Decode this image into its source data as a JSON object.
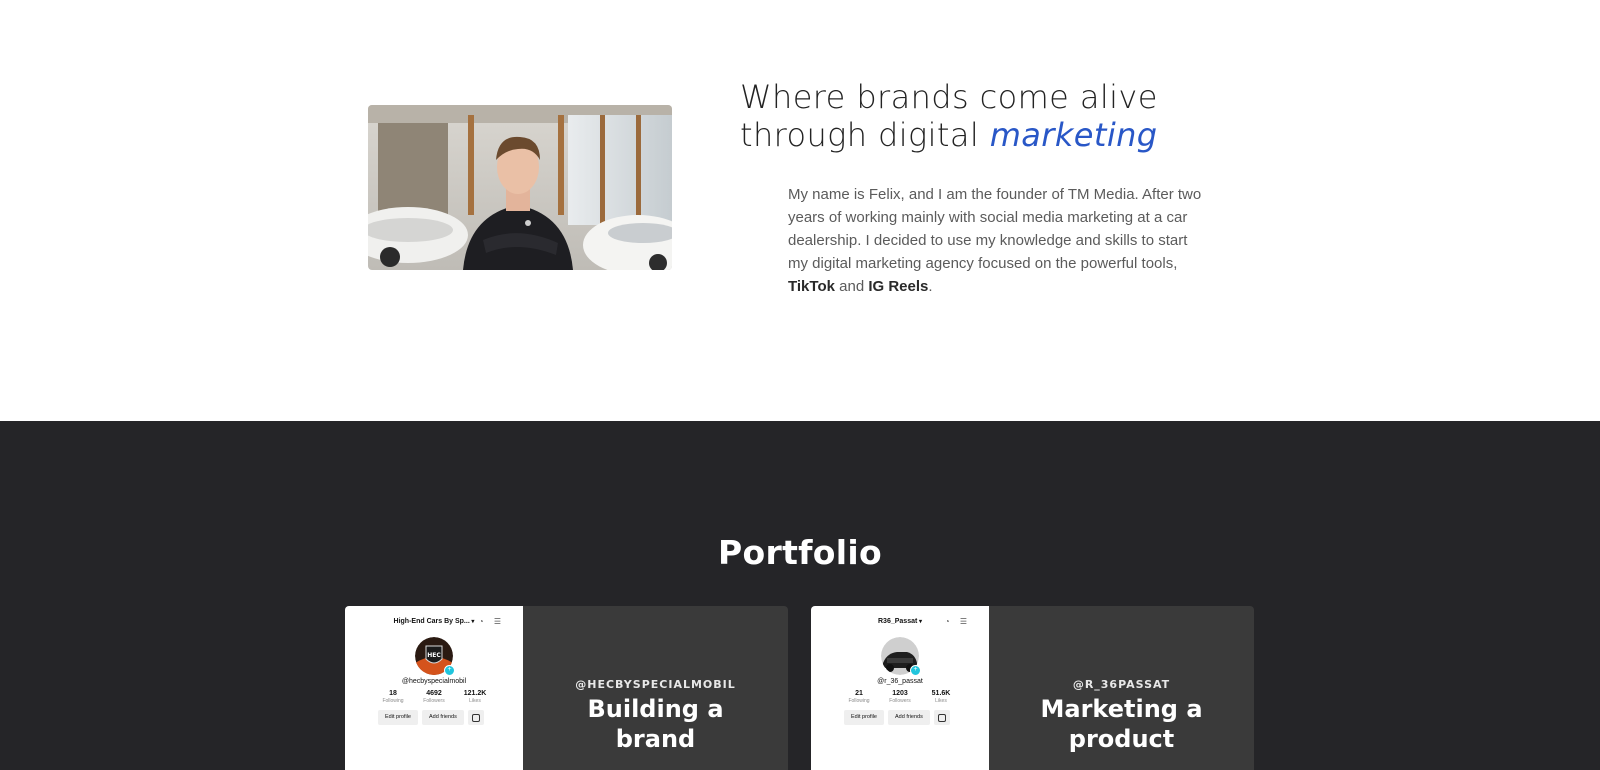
{
  "about": {
    "headline_line1": "Where brands come alive",
    "headline_line2_prefix": "through digital ",
    "headline_accent": "marketing",
    "bio_intro": "My name is Felix, and I am the founder of TM Media. After two years of working mainly with social media marketing at a car dealership. I decided to use my knowledge and skills to start my digital marketing agency focused on the powerful tools, ",
    "bio_tool1": "TikTok",
    "bio_and": " and ",
    "bio_tool2": "IG Reels",
    "bio_end": ".",
    "accent_color": "#2957c7"
  },
  "portfolio": {
    "title": "Portfolio",
    "background": "#252528",
    "cards": [
      {
        "handle": "@HECBYSPECIALMOBIL",
        "title": "Building a brand",
        "screenshot": {
          "account_name": "High-End Cars By Sp...",
          "username": "@hecbyspecialmobil",
          "following": "18",
          "following_label": "Following",
          "followers": "4692",
          "followers_label": "Followers",
          "likes": "121.2K",
          "likes_label": "Likes",
          "edit_profile": "Edit profile",
          "add_friends": "Add friends",
          "avatar_text": "HEC"
        }
      },
      {
        "handle": "@R_36PASSAT",
        "title": "Marketing a product",
        "screenshot": {
          "account_name": "R36_Passat",
          "username": "@r_36_passat",
          "following": "21",
          "following_label": "Following",
          "followers": "1203",
          "followers_label": "Followers",
          "likes": "51.6K",
          "likes_label": "Likes",
          "edit_profile": "Edit profile",
          "add_friends": "Add friends"
        }
      }
    ]
  }
}
